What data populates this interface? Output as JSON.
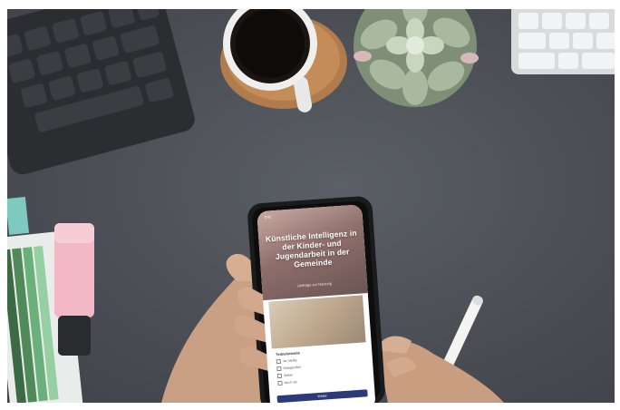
{
  "scene": {
    "description_objects": [
      "keyboard",
      "coffee-cup",
      "succulent",
      "highlighter",
      "pen",
      "smartphone",
      "hands"
    ]
  },
  "phone": {
    "status_time": "9:41",
    "hero_title": "Künstliche Intelligenz in der Kinder- und Jugendarbeit in der Gemeinde",
    "hero_subtitle": "Umfrage zur Nutzung",
    "question_title": "Teilnehmende",
    "options": [
      "Ja, häufig",
      "Gelegentlich",
      "Selten",
      "Noch nie"
    ],
    "button_label": "Weiter"
  },
  "colors": {
    "desk": "#4b4f55",
    "highlighter": "#f2b9c4",
    "button": "#2d3a7a"
  }
}
